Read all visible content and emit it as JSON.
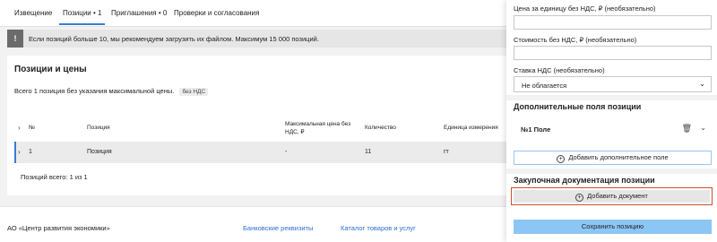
{
  "tabs": [
    {
      "label": "Извещение"
    },
    {
      "label": "Позиции • 1"
    },
    {
      "label": "Приглашения • 0"
    },
    {
      "label": "Проверки и согласования"
    }
  ],
  "notice": {
    "icon": "info-icon",
    "icon_char": "!",
    "text": "Если позиций больше 10, мы рекомендуем загрузить их файлом. Максимум 15 000 позиций."
  },
  "positions": {
    "title": "Позиции и цены",
    "summary": "Всего 1 позиция без указания максимальной цены.",
    "badge": "без НДС",
    "columns": {
      "num": "№",
      "name": "Позиция",
      "max_price": "Максимальная цена без НДС, ₽",
      "quantity": "Количество",
      "unit": "Единица измерения"
    },
    "rows": [
      {
        "num": "1",
        "name": "Позиция",
        "max_price": "-",
        "quantity": "11",
        "unit": "гт"
      }
    ],
    "pager": "Позиций всего: 1 из 1"
  },
  "footer": {
    "company": "АО «Центр развития экономики»",
    "link_bank": "Банковские реквизиты",
    "link_catalog": "Каталог товаров и услуг"
  },
  "panel": {
    "unit_price_label": "Цена за единицу без НДС, ₽ (необязательно)",
    "unit_price_value": "",
    "cost_label": "Стоимость без НДС, ₽ (необязательно)",
    "cost_value": "",
    "vat_label": "Ставка НДС (необязательно)",
    "vat_value": "Не облагается",
    "extra_title": "Дополнительные поля позиции",
    "field_name": "№1 Поле",
    "add_field": "Добавить дополнительное поле",
    "docs_title": "Закупочная документация позиции",
    "add_doc": "Добавить документ",
    "save": "Сохранить позицию"
  },
  "colors": {
    "accent": "#3b7bd9",
    "save_button": "#8cc6f5",
    "highlight_border": "#c9502f"
  }
}
